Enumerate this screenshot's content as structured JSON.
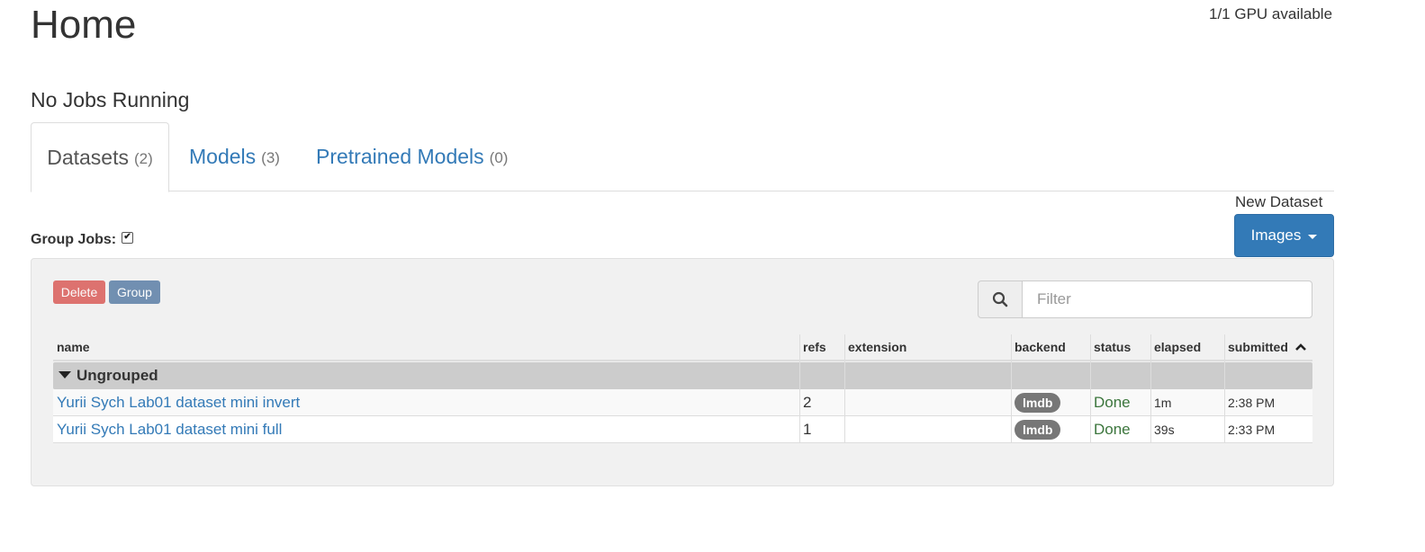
{
  "header": {
    "title": "Home",
    "gpu_status": "1/1 GPU available",
    "jobs_status": "No Jobs Running"
  },
  "tabs": [
    {
      "label": "Datasets",
      "count": "(2)",
      "active": true
    },
    {
      "label": "Models",
      "count": "(3)",
      "active": false
    },
    {
      "label": "Pretrained Models",
      "count": "(0)",
      "active": false
    }
  ],
  "new_dataset": {
    "label": "New Dataset",
    "button_label": "Images"
  },
  "group_jobs": {
    "label": "Group Jobs:",
    "checked": true
  },
  "toolbar": {
    "delete_label": "Delete",
    "group_label": "Group",
    "filter_placeholder": "Filter"
  },
  "table": {
    "columns": [
      "name",
      "refs",
      "extension",
      "backend",
      "status",
      "elapsed",
      "submitted"
    ],
    "sorted_column": "submitted",
    "groups": [
      {
        "label": "Ungrouped",
        "rows": [
          {
            "name": "Yurii Sych Lab01 dataset mini invert",
            "refs": "2",
            "extension": "",
            "backend": "lmdb",
            "status": "Done",
            "elapsed": "1m",
            "submitted": "2:38 PM"
          },
          {
            "name": "Yurii Sych Lab01 dataset mini full",
            "refs": "1",
            "extension": "",
            "backend": "lmdb",
            "status": "Done",
            "elapsed": "39s",
            "submitted": "2:33 PM"
          }
        ]
      }
    ]
  },
  "colors": {
    "link": "#337ab7",
    "primary_button": "#337ab7",
    "delete_button": "#d9534f",
    "status_done": "#3c763d",
    "badge": "#777777"
  },
  "icons": {
    "search": "search-icon",
    "dropdown": "caret-down-icon",
    "group_toggle": "triangle-down-icon",
    "sort": "sort-ascending-icon"
  }
}
